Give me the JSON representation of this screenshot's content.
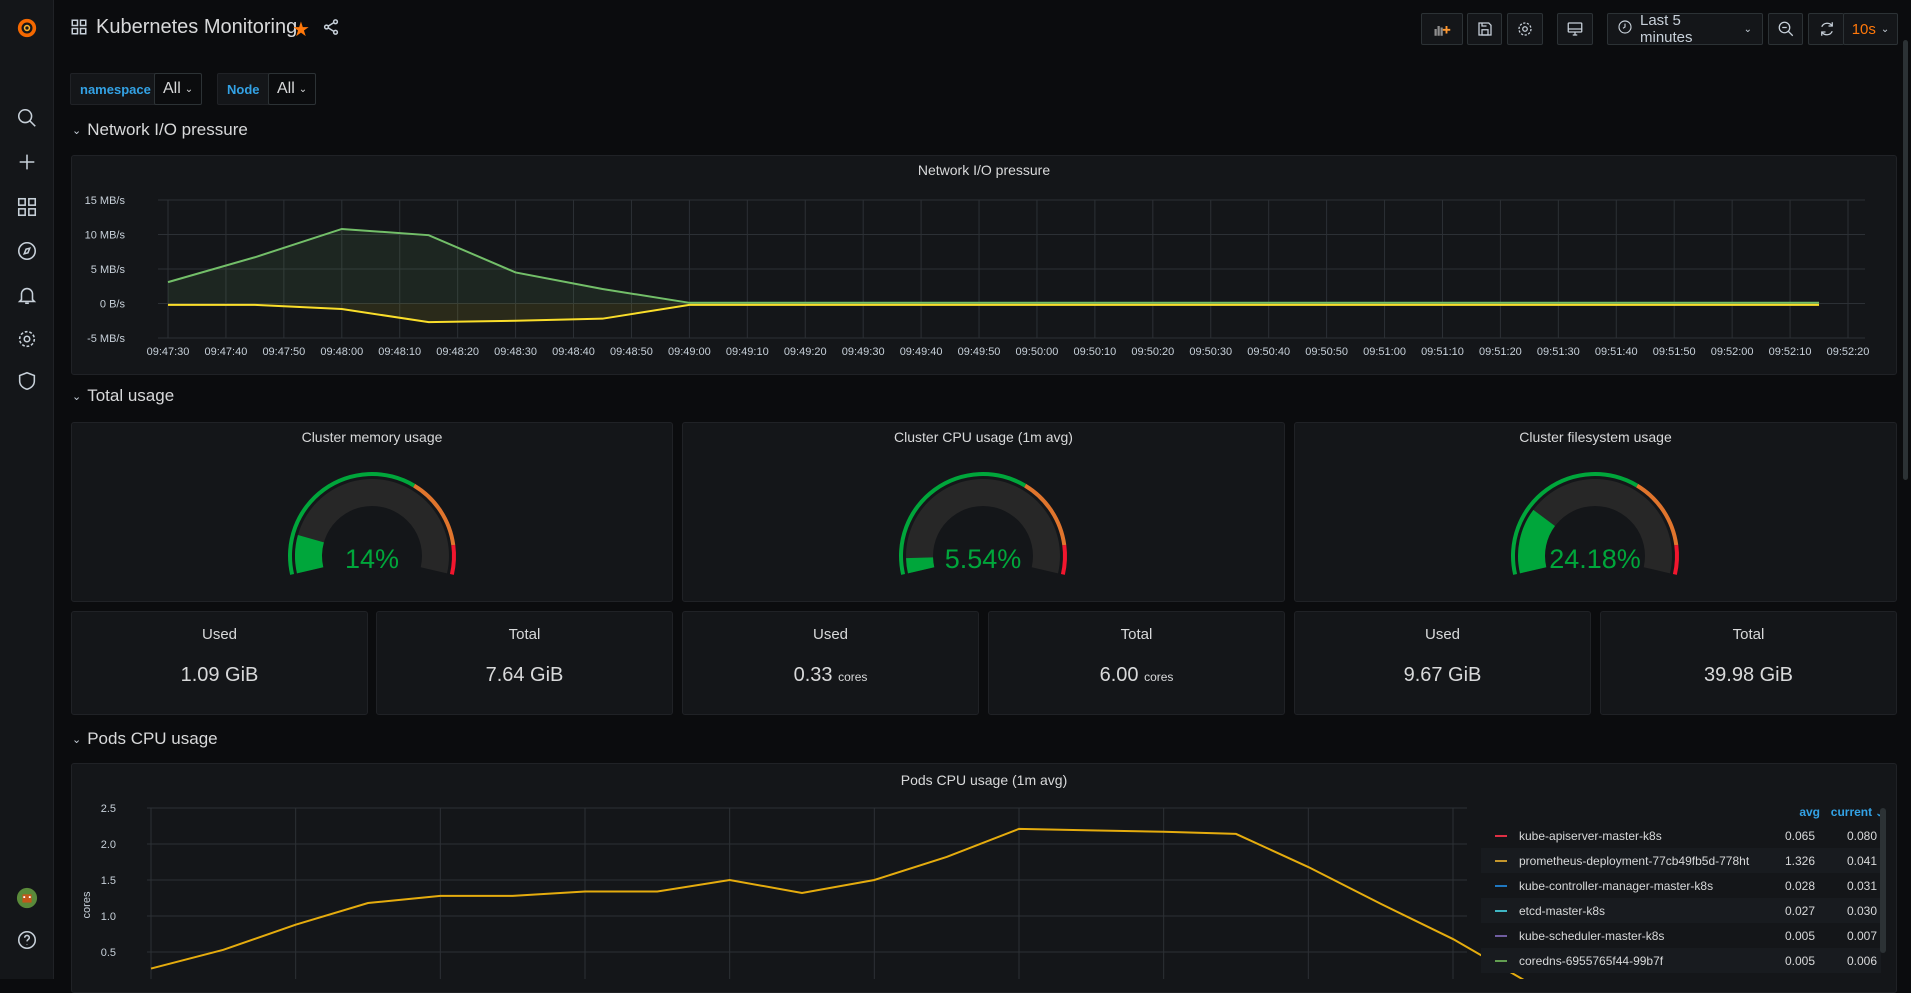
{
  "header": {
    "title": "Kubernetes Monitoring",
    "starred": true,
    "time_range": "Last 5 minutes",
    "refresh": "10s"
  },
  "variables": [
    {
      "label": "namespace",
      "value": "All"
    },
    {
      "label": "Node",
      "value": "All"
    }
  ],
  "sidebar": {
    "items": [
      "grafana-logo",
      "search",
      "create",
      "dashboards",
      "explore",
      "alerting",
      "configuration",
      "server-admin"
    ],
    "bottom": [
      "profile",
      "help"
    ]
  },
  "rows": {
    "network": "Network I/O pressure",
    "total": "Total usage",
    "pods": "Pods CPU usage"
  },
  "colors": {
    "green": "#73bf69",
    "yellow": "#fade2a",
    "orange": "#ff9830",
    "gauge_green": "#00a63b",
    "gauge_orange": "#e0752d",
    "gauge_red": "#f2162e",
    "accent": "#33a2e5",
    "refresh": "#ff780a"
  },
  "gauges": [
    {
      "title": "Cluster memory usage",
      "value": 14,
      "display": "14%"
    },
    {
      "title": "Cluster CPU usage (1m avg)",
      "value": 5.54,
      "display": "5.54%"
    },
    {
      "title": "Cluster filesystem usage",
      "value": 24.18,
      "display": "24.18%"
    }
  ],
  "gauge_thresholds": [
    65,
    90
  ],
  "stats": [
    {
      "title": "Used",
      "value": "1.09 GiB",
      "unit": ""
    },
    {
      "title": "Total",
      "value": "7.64 GiB",
      "unit": ""
    },
    {
      "title": "Used",
      "value": "0.33",
      "unit": "cores"
    },
    {
      "title": "Total",
      "value": "6.00",
      "unit": "cores"
    },
    {
      "title": "Used",
      "value": "9.67 GiB",
      "unit": ""
    },
    {
      "title": "Total",
      "value": "39.98 GiB",
      "unit": ""
    }
  ],
  "chart_data": [
    {
      "type": "area",
      "title": "Network I/O pressure",
      "xlabel": "",
      "ylabel": "",
      "ylim": [
        -5,
        15
      ],
      "yticks": [
        "15 MB/s",
        "10 MB/s",
        "5 MB/s",
        "0 B/s",
        "-5 MB/s"
      ],
      "yticks_values": [
        15,
        10,
        5,
        0,
        -5
      ],
      "xticks": [
        "09:47:30",
        "09:47:40",
        "09:47:50",
        "09:48:00",
        "09:48:10",
        "09:48:20",
        "09:48:30",
        "09:48:40",
        "09:48:50",
        "09:49:00",
        "09:49:10",
        "09:49:20",
        "09:49:30",
        "09:49:40",
        "09:49:50",
        "09:50:00",
        "09:50:10",
        "09:50:20",
        "09:50:30",
        "09:50:40",
        "09:50:50",
        "09:51:00",
        "09:51:10",
        "09:51:20",
        "09:51:30",
        "09:51:40",
        "09:51:50",
        "09:52:00",
        "09:52:10",
        "09:52:20"
      ],
      "x": [
        "09:47:30",
        "09:47:45",
        "09:48:00",
        "09:48:15",
        "09:48:30",
        "09:48:45",
        "09:49:00",
        "09:49:15",
        "09:49:30",
        "09:49:45",
        "09:50:00",
        "09:50:15",
        "09:50:30",
        "09:50:45",
        "09:51:00",
        "09:51:15",
        "09:51:30",
        "09:51:45",
        "09:52:00",
        "09:52:15"
      ],
      "series": [
        {
          "color": "#73bf69",
          "values": [
            3.1,
            6.7,
            10.8,
            9.9,
            4.5,
            2.1,
            0.1,
            0.1,
            0.1,
            0.1,
            0.1,
            0.1,
            0.1,
            0.1,
            0.1,
            0.1,
            0.1,
            0.1,
            0.1,
            0.1
          ]
        },
        {
          "color": "#fade2a",
          "values": [
            -0.2,
            -0.2,
            -0.8,
            -2.7,
            -2.5,
            -2.2,
            -0.2,
            -0.2,
            -0.2,
            -0.2,
            -0.2,
            -0.2,
            -0.2,
            -0.2,
            -0.2,
            -0.2,
            -0.2,
            -0.2,
            -0.2,
            -0.2
          ]
        }
      ],
      "grid": true
    },
    {
      "type": "line",
      "title": "Pods CPU usage (1m avg)",
      "xlabel": "",
      "ylabel": "cores",
      "ylim": [
        0,
        2.5
      ],
      "yticks": [
        "2.5",
        "2.0",
        "1.5",
        "1.0",
        "0.5"
      ],
      "yticks_values": [
        2.5,
        2.0,
        1.5,
        1.0,
        0.5
      ],
      "series": [
        {
          "color": "#e5ac0e",
          "values": [
            0.27,
            0.53,
            0.88,
            1.18,
            1.28,
            1.28,
            1.34,
            1.34,
            1.5,
            1.32,
            1.5,
            1.82,
            2.21,
            2.19,
            2.17,
            2.14,
            1.68,
            1.17,
            0.68,
            0.1
          ]
        }
      ],
      "grid": true,
      "legend": {
        "placement": "right",
        "columns": [
          "avg",
          "current"
        ],
        "sort": "current",
        "items": [
          {
            "name": "kube-apiserver-master-k8s",
            "color": "#e02f44",
            "avg": "0.065",
            "current": "0.080"
          },
          {
            "name": "prometheus-deployment-77cb49fb5d-778ht",
            "color": "#c4962c",
            "avg": "1.326",
            "current": "0.041"
          },
          {
            "name": "kube-controller-manager-master-k8s",
            "color": "#1f78c1",
            "avg": "0.028",
            "current": "0.031"
          },
          {
            "name": "etcd-master-k8s",
            "color": "#3fb6c4",
            "avg": "0.027",
            "current": "0.030"
          },
          {
            "name": "kube-scheduler-master-k8s",
            "color": "#705da0",
            "avg": "0.005",
            "current": "0.007"
          },
          {
            "name": "coredns-6955765f44-99b7f",
            "color": "#629e51",
            "avg": "0.005",
            "current": "0.006"
          }
        ]
      }
    }
  ]
}
